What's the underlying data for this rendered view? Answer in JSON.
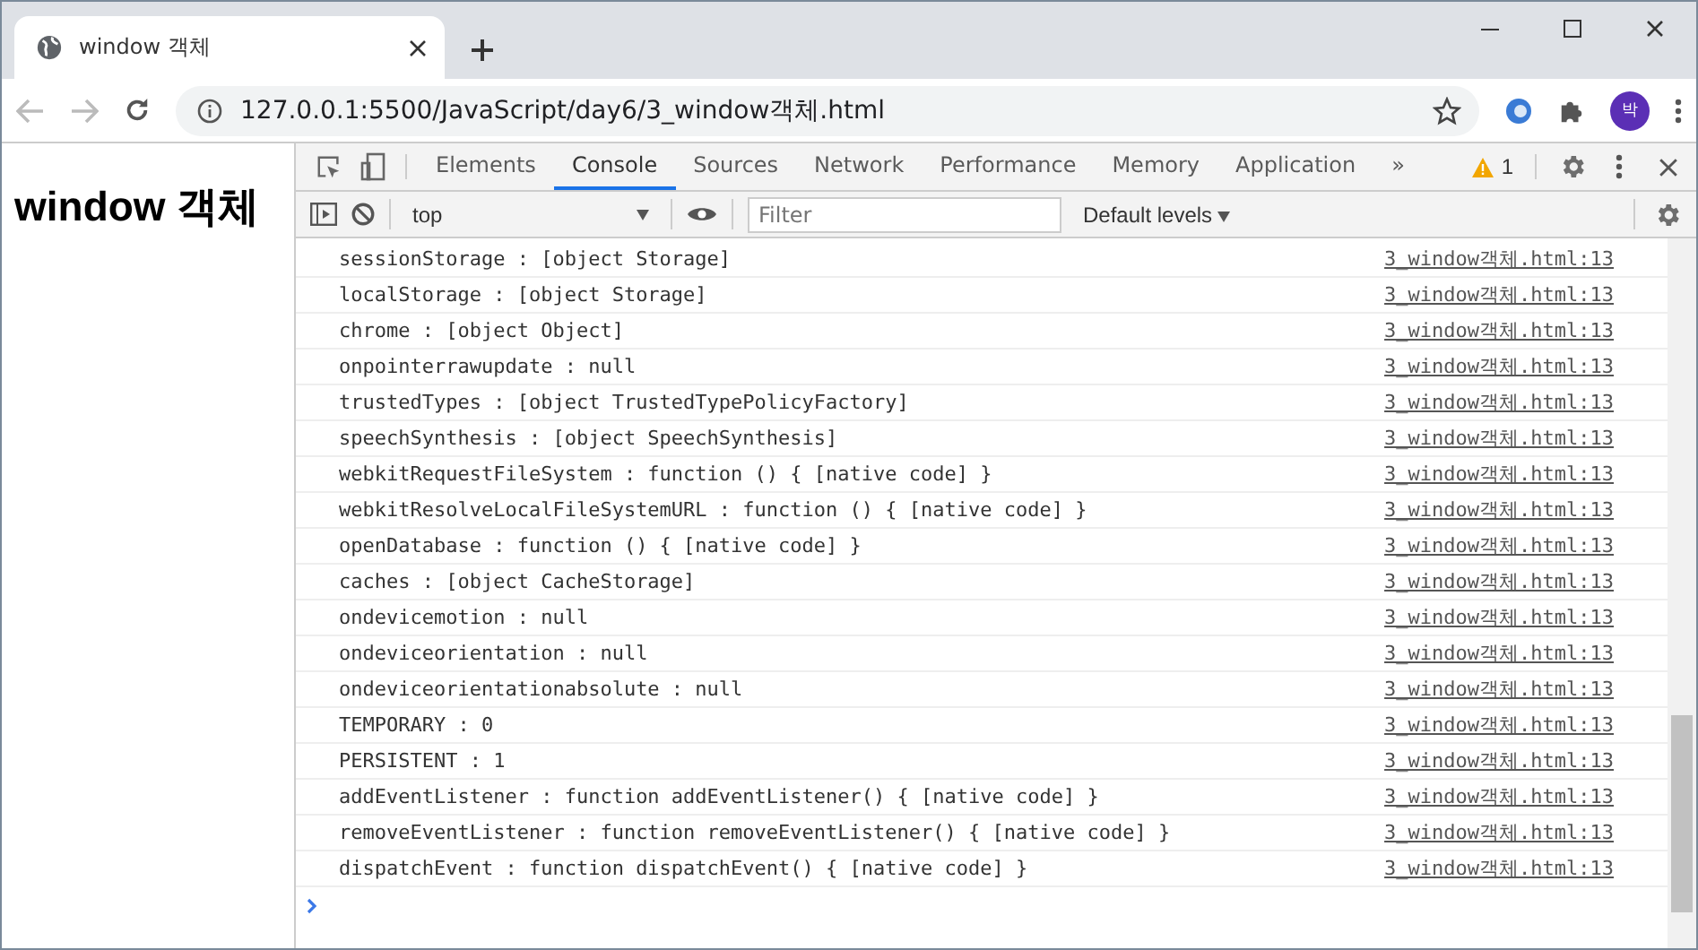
{
  "browser": {
    "tab_title": "window 객체",
    "url": "127.0.0.1:5500/JavaScript/day6/3_window객체.html",
    "avatar": "박"
  },
  "page": {
    "heading": "window 객체"
  },
  "devtools": {
    "tabs": [
      {
        "label": "Elements",
        "selected": false
      },
      {
        "label": "Console",
        "selected": true
      },
      {
        "label": "Sources",
        "selected": false
      },
      {
        "label": "Network",
        "selected": false
      },
      {
        "label": "Performance",
        "selected": false
      },
      {
        "label": "Memory",
        "selected": false
      },
      {
        "label": "Application",
        "selected": false
      }
    ],
    "more_tabs": "»",
    "warnings": "1",
    "context": "top",
    "filter_placeholder": "Filter",
    "levels": "Default levels"
  },
  "console": {
    "rows": [
      {
        "message": "sessionStorage : [object Storage]",
        "source": "3_window객체.html:13"
      },
      {
        "message": "localStorage : [object Storage]",
        "source": "3_window객체.html:13"
      },
      {
        "message": "chrome : [object Object]",
        "source": "3_window객체.html:13"
      },
      {
        "message": "onpointerrawupdate : null",
        "source": "3_window객체.html:13"
      },
      {
        "message": "trustedTypes : [object TrustedTypePolicyFactory]",
        "source": "3_window객체.html:13"
      },
      {
        "message": "speechSynthesis : [object SpeechSynthesis]",
        "source": "3_window객체.html:13"
      },
      {
        "message": "webkitRequestFileSystem : function () { [native code] }",
        "source": "3_window객체.html:13"
      },
      {
        "message": "webkitResolveLocalFileSystemURL : function () { [native code] }",
        "source": "3_window객체.html:13"
      },
      {
        "message": "openDatabase : function () { [native code] }",
        "source": "3_window객체.html:13"
      },
      {
        "message": "caches : [object CacheStorage]",
        "source": "3_window객체.html:13"
      },
      {
        "message": "ondevicemotion : null",
        "source": "3_window객체.html:13"
      },
      {
        "message": "ondeviceorientation : null",
        "source": "3_window객체.html:13"
      },
      {
        "message": "ondeviceorientationabsolute : null",
        "source": "3_window객체.html:13"
      },
      {
        "message": "TEMPORARY : 0",
        "source": "3_window객체.html:13"
      },
      {
        "message": "PERSISTENT : 1",
        "source": "3_window객체.html:13"
      },
      {
        "message": "addEventListener : function addEventListener() { [native code] }",
        "source": "3_window객체.html:13"
      },
      {
        "message": "removeEventListener : function removeEventListener() { [native code] }",
        "source": "3_window객체.html:13"
      },
      {
        "message": "dispatchEvent : function dispatchEvent() { [native code] }",
        "source": "3_window객체.html:13"
      }
    ]
  }
}
